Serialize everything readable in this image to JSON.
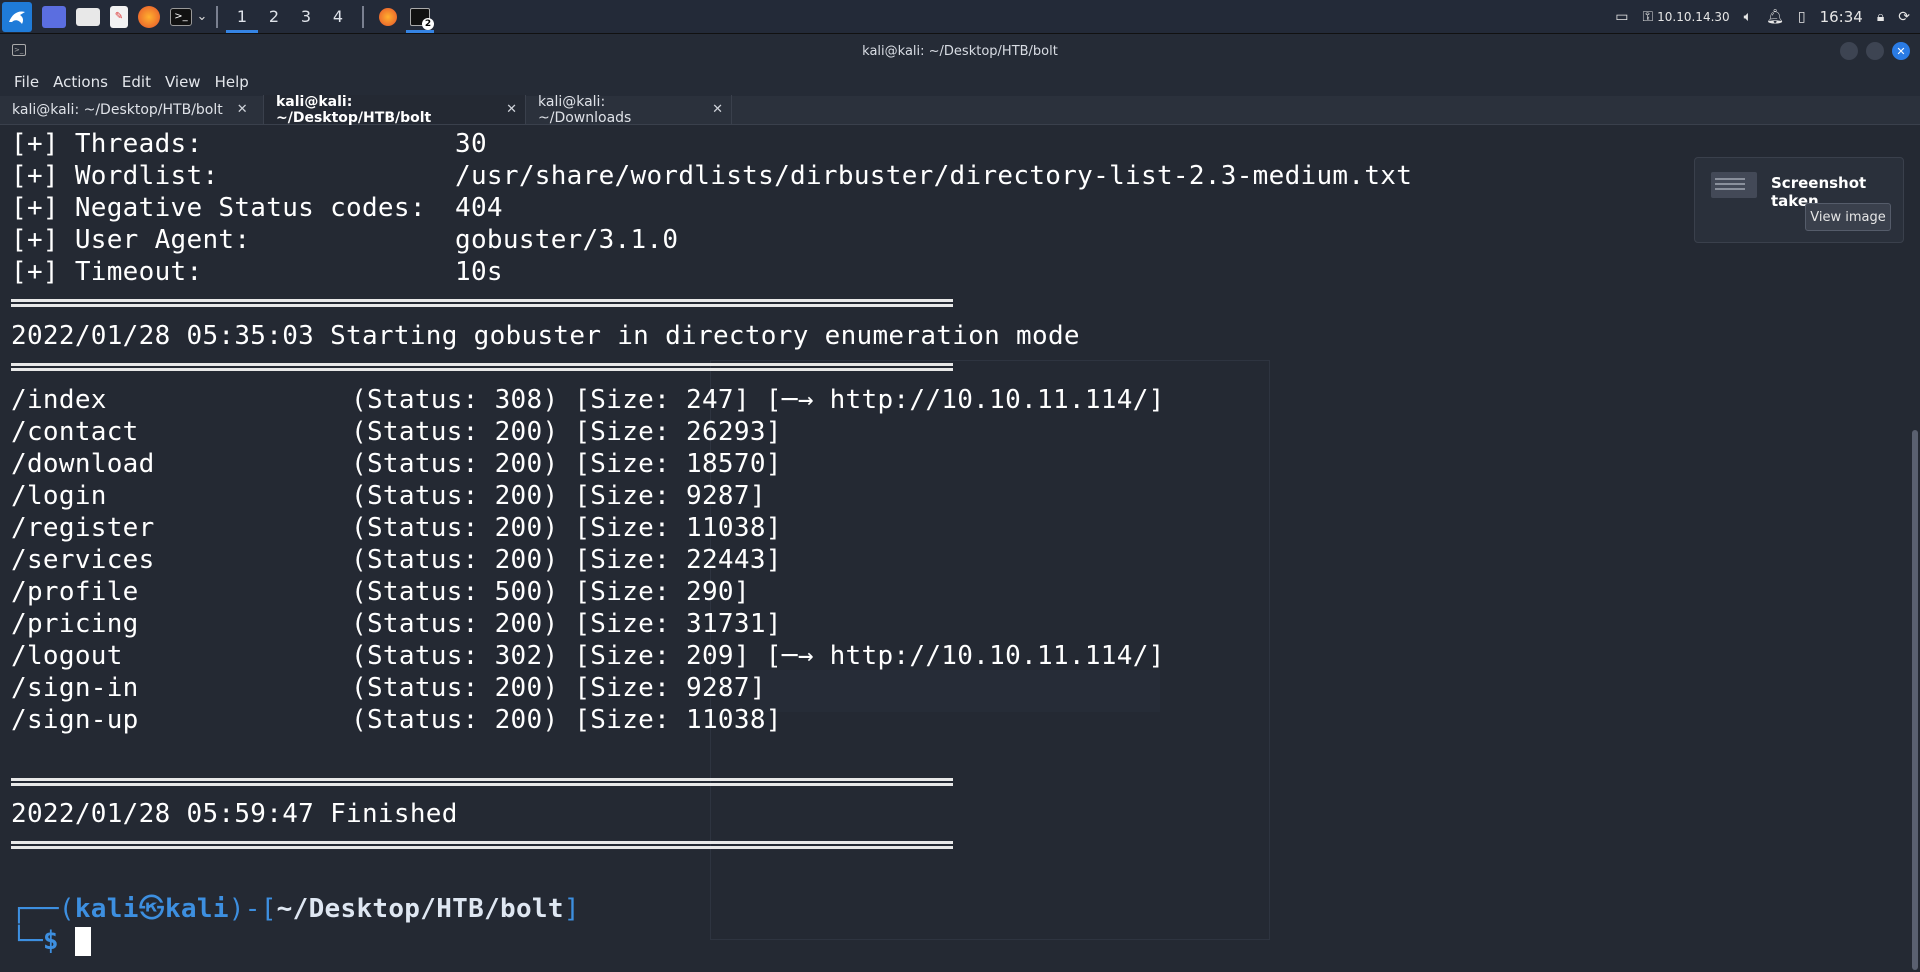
{
  "panel": {
    "workspaces": [
      "1",
      "2",
      "3",
      "4"
    ],
    "active_workspace": "1",
    "terminal_badge": "2",
    "ip": "10.10.14.30",
    "clock": "16:34"
  },
  "window": {
    "title": "kali@kali: ~/Desktop/HTB/bolt",
    "menu": [
      "File",
      "Actions",
      "Edit",
      "View",
      "Help"
    ],
    "tabs": [
      {
        "label": "kali@kali: ~/Desktop/HTB/bolt",
        "active": false
      },
      {
        "label": "kali@kali: ~/Desktop/HTB/bolt",
        "active": true
      },
      {
        "label": "kali@kali: ~/Downloads",
        "active": false
      }
    ]
  },
  "terminal": {
    "config": [
      {
        "key": "[+] Threads:",
        "value": "30"
      },
      {
        "key": "[+] Wordlist:",
        "value": "/usr/share/wordlists/dirbuster/directory-list-2.3-medium.txt"
      },
      {
        "key": "[+] Negative Status codes:",
        "value": "404"
      },
      {
        "key": "[+] User Agent:",
        "value": "gobuster/3.1.0"
      },
      {
        "key": "[+] Timeout:",
        "value": "10s"
      }
    ],
    "start_line": "2022/01/28 05:35:03 Starting gobuster in directory enumeration mode",
    "results": [
      {
        "path": "/index",
        "info": "(Status: 308) [Size: 247] [─→ http://10.10.11.114/]"
      },
      {
        "path": "/contact",
        "info": "(Status: 200) [Size: 26293]"
      },
      {
        "path": "/download",
        "info": "(Status: 200) [Size: 18570]"
      },
      {
        "path": "/login",
        "info": "(Status: 200) [Size: 9287]"
      },
      {
        "path": "/register",
        "info": "(Status: 200) [Size: 11038]"
      },
      {
        "path": "/services",
        "info": "(Status: 200) [Size: 22443]"
      },
      {
        "path": "/profile",
        "info": "(Status: 500) [Size: 290]"
      },
      {
        "path": "/pricing",
        "info": "(Status: 200) [Size: 31731]"
      },
      {
        "path": "/logout",
        "info": "(Status: 302) [Size: 209] [─→ http://10.10.11.114/]"
      },
      {
        "path": "/sign-in",
        "info": "(Status: 200) [Size: 9287]"
      },
      {
        "path": "/sign-up",
        "info": "(Status: 200) [Size: 11038]"
      }
    ],
    "finish_line": "2022/01/28 05:59:47 Finished",
    "prompt": {
      "open": "┌──(",
      "user": "kali",
      "sep": "㉿",
      "host": "kali",
      "mid": ")-[",
      "cwd": "~/Desktop/HTB/bolt",
      "close": "]",
      "second": "└─",
      "dollar": "$ "
    }
  },
  "notification": {
    "title": "Screenshot taken",
    "button": "View image"
  },
  "colors": {
    "accent": "#3584e4",
    "terminal_bg": "#242933",
    "prompt_blue": "#3d8fe0"
  }
}
